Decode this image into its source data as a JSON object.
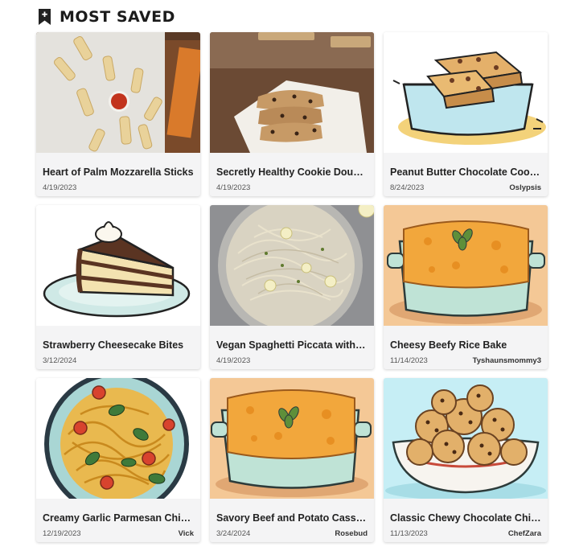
{
  "section": {
    "title": "MOST SAVED",
    "icon": "bookmark-plus-icon"
  },
  "cards": [
    {
      "title": "Heart of Palm Mozzarella Sticks",
      "date": "4/19/2023",
      "author": "",
      "image": "mozzarella-sticks-photo"
    },
    {
      "title": "Secretly Healthy Cookie Dough Bars",
      "date": "4/19/2023",
      "author": "",
      "image": "cookie-dough-bars-photo"
    },
    {
      "title": "Peanut Butter Chocolate Cookie Bars",
      "date": "8/24/2023",
      "author": "Oslypsis",
      "image": "cookie-bars-illustration"
    },
    {
      "title": "Strawberry Cheesecake Bites",
      "date": "3/12/2024",
      "author": "",
      "image": "cake-slice-illustration"
    },
    {
      "title": "Vegan Spaghetti Piccata with Lemon",
      "date": "4/19/2023",
      "author": "",
      "image": "spaghetti-pan-photo"
    },
    {
      "title": "Cheesy Beefy Rice Bake",
      "date": "11/14/2023",
      "author": "Tyshaunsmommy3",
      "image": "casserole-illustration"
    },
    {
      "title": "Creamy Garlic Parmesan Chicken Pasta",
      "date": "12/19/2023",
      "author": "Vick",
      "image": "pasta-plate-illustration"
    },
    {
      "title": "Savory Beef and Potato Casserole",
      "date": "3/24/2024",
      "author": "Rosebud",
      "image": "casserole-illustration"
    },
    {
      "title": "Classic Chewy Chocolate Chip Cookies",
      "date": "11/13/2023",
      "author": "ChefZara",
      "image": "cookies-bowl-illustration"
    }
  ]
}
